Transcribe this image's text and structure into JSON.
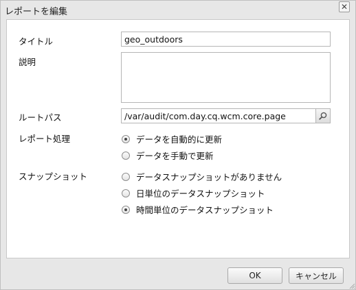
{
  "dialog": {
    "title": "レポートを編集",
    "close_symbol": "✕"
  },
  "form": {
    "title_label": "タイトル",
    "title_value": "geo_outdoors",
    "description_label": "説明",
    "description_value": "",
    "rootpath_label": "ルートパス",
    "rootpath_value": "/var/audit/com.day.cq.wcm.core.page",
    "processing_label": "レポート処理",
    "processing_options": [
      {
        "label": "データを自動的に更新",
        "checked": true
      },
      {
        "label": "データを手動で更新",
        "checked": false
      }
    ],
    "snapshots_label": "スナップショット",
    "snapshot_options": [
      {
        "label": "データスナップショットがありません",
        "checked": false
      },
      {
        "label": "日単位のデータスナップショット",
        "checked": false
      },
      {
        "label": "時間単位のデータスナップショット",
        "checked": true
      }
    ]
  },
  "footer": {
    "ok_label": "OK",
    "cancel_label": "キャンセル"
  },
  "icons": {
    "close": "close-icon",
    "search": "search-icon",
    "resize": "resize-grip-icon"
  }
}
